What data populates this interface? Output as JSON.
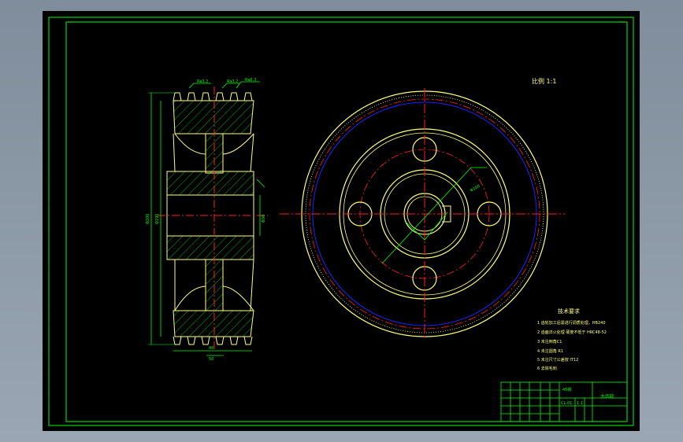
{
  "drawing": {
    "scale_note": "比例 1:1",
    "tech_requirements": {
      "title": "技术要求",
      "items": [
        "1 齿轮加工后需进行调质处理，HB240",
        "2 齿面淬火处理 硬度不低于 HRC48-52",
        "3 未注倒角C1",
        "4 未注圆角 R1",
        "5 未注尺寸公差按 IT12",
        "6 去除毛刺"
      ]
    },
    "title_block": {
      "part_name": "大齿轮",
      "material": "45钢",
      "scale": "1:1",
      "drawing_no": "CL-01"
    },
    "dims": {
      "top_1": "Ra3.2",
      "top_2": "Ra3.2",
      "top_3": "Ra6.3",
      "left_1": "Φ200",
      "left_2": "Φ190",
      "bottom_1": "40",
      "bottom_2": "50",
      "right_1": "Φ30",
      "pitch_note": "Φ100"
    }
  },
  "colors": {
    "background": "#000000",
    "frame": "#00ff00",
    "gear": "#ffff80",
    "center_line": "#ff2020",
    "root_circle": "#2020ff",
    "hatch": "#00ff00"
  }
}
